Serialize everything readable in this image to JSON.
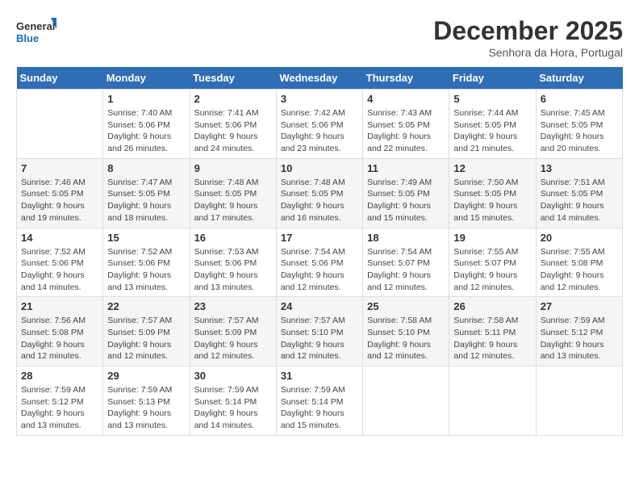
{
  "logo": {
    "line1": "General",
    "line2": "Blue"
  },
  "title": "December 2025",
  "subtitle": "Senhora da Hora, Portugal",
  "weekdays": [
    "Sunday",
    "Monday",
    "Tuesday",
    "Wednesday",
    "Thursday",
    "Friday",
    "Saturday"
  ],
  "weeks": [
    [
      {
        "day": "",
        "info": ""
      },
      {
        "day": "1",
        "info": "Sunrise: 7:40 AM\nSunset: 5:06 PM\nDaylight: 9 hours\nand 26 minutes."
      },
      {
        "day": "2",
        "info": "Sunrise: 7:41 AM\nSunset: 5:06 PM\nDaylight: 9 hours\nand 24 minutes."
      },
      {
        "day": "3",
        "info": "Sunrise: 7:42 AM\nSunset: 5:06 PM\nDaylight: 9 hours\nand 23 minutes."
      },
      {
        "day": "4",
        "info": "Sunrise: 7:43 AM\nSunset: 5:05 PM\nDaylight: 9 hours\nand 22 minutes."
      },
      {
        "day": "5",
        "info": "Sunrise: 7:44 AM\nSunset: 5:05 PM\nDaylight: 9 hours\nand 21 minutes."
      },
      {
        "day": "6",
        "info": "Sunrise: 7:45 AM\nSunset: 5:05 PM\nDaylight: 9 hours\nand 20 minutes."
      }
    ],
    [
      {
        "day": "7",
        "info": "Sunrise: 7:46 AM\nSunset: 5:05 PM\nDaylight: 9 hours\nand 19 minutes."
      },
      {
        "day": "8",
        "info": "Sunrise: 7:47 AM\nSunset: 5:05 PM\nDaylight: 9 hours\nand 18 minutes."
      },
      {
        "day": "9",
        "info": "Sunrise: 7:48 AM\nSunset: 5:05 PM\nDaylight: 9 hours\nand 17 minutes."
      },
      {
        "day": "10",
        "info": "Sunrise: 7:48 AM\nSunset: 5:05 PM\nDaylight: 9 hours\nand 16 minutes."
      },
      {
        "day": "11",
        "info": "Sunrise: 7:49 AM\nSunset: 5:05 PM\nDaylight: 9 hours\nand 15 minutes."
      },
      {
        "day": "12",
        "info": "Sunrise: 7:50 AM\nSunset: 5:05 PM\nDaylight: 9 hours\nand 15 minutes."
      },
      {
        "day": "13",
        "info": "Sunrise: 7:51 AM\nSunset: 5:05 PM\nDaylight: 9 hours\nand 14 minutes."
      }
    ],
    [
      {
        "day": "14",
        "info": "Sunrise: 7:52 AM\nSunset: 5:06 PM\nDaylight: 9 hours\nand 14 minutes."
      },
      {
        "day": "15",
        "info": "Sunrise: 7:52 AM\nSunset: 5:06 PM\nDaylight: 9 hours\nand 13 minutes."
      },
      {
        "day": "16",
        "info": "Sunrise: 7:53 AM\nSunset: 5:06 PM\nDaylight: 9 hours\nand 13 minutes."
      },
      {
        "day": "17",
        "info": "Sunrise: 7:54 AM\nSunset: 5:06 PM\nDaylight: 9 hours\nand 12 minutes."
      },
      {
        "day": "18",
        "info": "Sunrise: 7:54 AM\nSunset: 5:07 PM\nDaylight: 9 hours\nand 12 minutes."
      },
      {
        "day": "19",
        "info": "Sunrise: 7:55 AM\nSunset: 5:07 PM\nDaylight: 9 hours\nand 12 minutes."
      },
      {
        "day": "20",
        "info": "Sunrise: 7:55 AM\nSunset: 5:08 PM\nDaylight: 9 hours\nand 12 minutes."
      }
    ],
    [
      {
        "day": "21",
        "info": "Sunrise: 7:56 AM\nSunset: 5:08 PM\nDaylight: 9 hours\nand 12 minutes."
      },
      {
        "day": "22",
        "info": "Sunrise: 7:57 AM\nSunset: 5:09 PM\nDaylight: 9 hours\nand 12 minutes."
      },
      {
        "day": "23",
        "info": "Sunrise: 7:57 AM\nSunset: 5:09 PM\nDaylight: 9 hours\nand 12 minutes."
      },
      {
        "day": "24",
        "info": "Sunrise: 7:57 AM\nSunset: 5:10 PM\nDaylight: 9 hours\nand 12 minutes."
      },
      {
        "day": "25",
        "info": "Sunrise: 7:58 AM\nSunset: 5:10 PM\nDaylight: 9 hours\nand 12 minutes."
      },
      {
        "day": "26",
        "info": "Sunrise: 7:58 AM\nSunset: 5:11 PM\nDaylight: 9 hours\nand 12 minutes."
      },
      {
        "day": "27",
        "info": "Sunrise: 7:59 AM\nSunset: 5:12 PM\nDaylight: 9 hours\nand 13 minutes."
      }
    ],
    [
      {
        "day": "28",
        "info": "Sunrise: 7:59 AM\nSunset: 5:12 PM\nDaylight: 9 hours\nand 13 minutes."
      },
      {
        "day": "29",
        "info": "Sunrise: 7:59 AM\nSunset: 5:13 PM\nDaylight: 9 hours\nand 13 minutes."
      },
      {
        "day": "30",
        "info": "Sunrise: 7:59 AM\nSunset: 5:14 PM\nDaylight: 9 hours\nand 14 minutes."
      },
      {
        "day": "31",
        "info": "Sunrise: 7:59 AM\nSunset: 5:14 PM\nDaylight: 9 hours\nand 15 minutes."
      },
      {
        "day": "",
        "info": ""
      },
      {
        "day": "",
        "info": ""
      },
      {
        "day": "",
        "info": ""
      }
    ]
  ]
}
